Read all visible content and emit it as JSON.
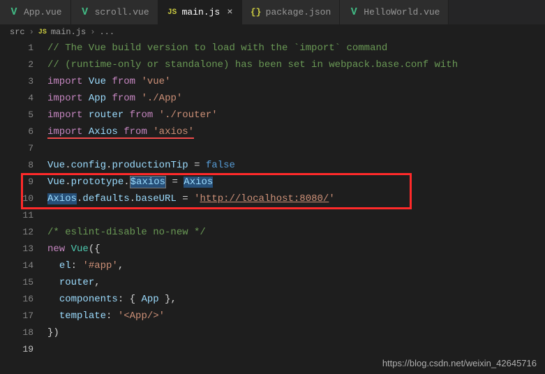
{
  "tabs": [
    {
      "icon": "vue",
      "label": "App.vue"
    },
    {
      "icon": "vue",
      "label": "scroll.vue"
    },
    {
      "icon": "js",
      "label": "main.js",
      "active": true
    },
    {
      "icon": "json",
      "label": "package.json"
    },
    {
      "icon": "vue",
      "label": "HelloWorld.vue"
    }
  ],
  "breadcrumb": {
    "root": "src",
    "file": "main.js",
    "more": "..."
  },
  "code": {
    "l1_comment": "// The Vue build version to load with the `import` command",
    "l2_comment": "// (runtime-only or standalone) has been set in webpack.base.conf with ",
    "import_kw": "import",
    "from_kw": "from",
    "new_kw": "new",
    "false_kw": "false",
    "vue": "Vue",
    "app": "App",
    "router": "router",
    "axios": "Axios",
    "str_vue": "'vue'",
    "str_app": "'./App'",
    "str_router": "'./router'",
    "str_axios": "'axios'",
    "config": "config",
    "productionTip": "productionTip",
    "prototype": "prototype",
    "dollar_axios": "$axios",
    "defaults": "defaults",
    "baseURL": "baseURL",
    "url_q1": "'",
    "url_val": "http://localhost:8080/",
    "url_q2": "'",
    "eslint_comment": "/* eslint-disable no-new */",
    "el": "el",
    "str_el": "'#app'",
    "components": "components",
    "template": "template",
    "str_template": "'<App/>'",
    "dot": ".",
    "eq": " = ",
    "colon": ": ",
    "comma": ",",
    "lparen": "(",
    "rparen": ")",
    "lbrace": "{",
    "rbrace": "}",
    "rparen_brace": "})",
    "lbrace_sp": "{ ",
    "rbrace_sp": " }"
  },
  "watermark": "https://blog.csdn.net/weixin_42645716"
}
